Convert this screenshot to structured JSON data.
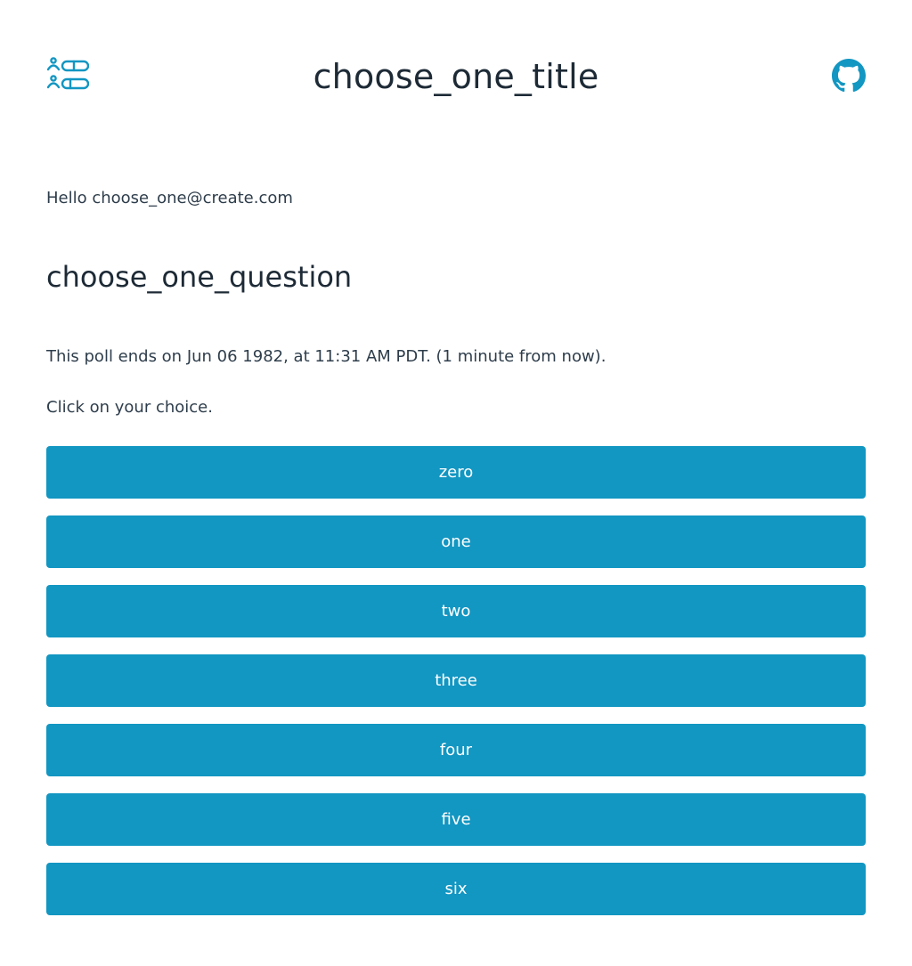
{
  "header": {
    "title": "choose_one_title",
    "logo_icon": "poll-list-icon",
    "github_icon": "github-icon",
    "accent_color": "#1296c2"
  },
  "greeting": "Hello choose_one@create.com",
  "poll": {
    "question": "choose_one_question",
    "deadline_text": "This poll ends on Jun 06 1982, at 11:31 AM PDT. (1 minute from now).",
    "instruction": "Click on your choice.",
    "choices": [
      "zero",
      "one",
      "two",
      "three",
      "four",
      "five",
      "six"
    ]
  },
  "colors": {
    "button_bg": "#1296c2",
    "button_text": "#ffffff",
    "text": "#2e3d4b"
  }
}
